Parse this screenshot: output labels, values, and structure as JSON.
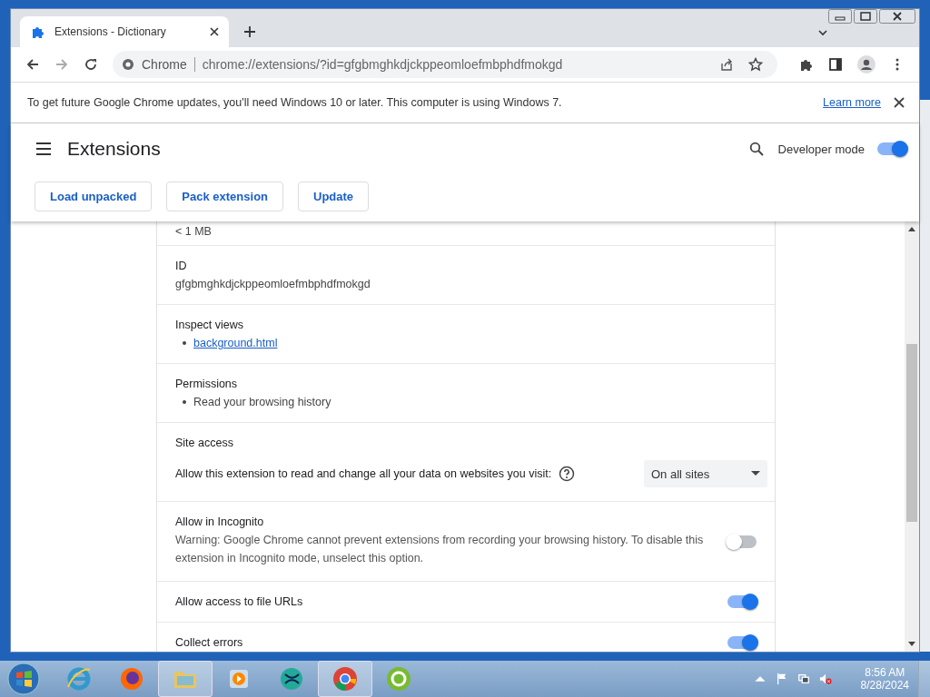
{
  "tabs": [
    {
      "label": "Extensions - Dictionary",
      "selected": true
    }
  ],
  "address": {
    "site_label": "Chrome",
    "url": "chrome://extensions/?id=gfgbmghkdjckppeomloefmbphdfmokgd"
  },
  "infobar": {
    "message": "To get future Google Chrome updates, you'll need Windows 10 or later. This computer is using Windows 7.",
    "link": "Learn more"
  },
  "header": {
    "title": "Extensions",
    "developer_mode": {
      "label": "Developer mode",
      "on": true
    }
  },
  "buttons": [
    "Load unpacked",
    "Pack extension",
    "Update"
  ],
  "details": {
    "size": "< 1 MB",
    "id": {
      "label": "ID",
      "value": "gfgbmghkdjckppeomloefmbphdfmokgd"
    },
    "inspect_views": {
      "label": "Inspect views",
      "links": [
        "background.html"
      ]
    },
    "permissions": {
      "label": "Permissions",
      "items": [
        "Read your browsing history"
      ]
    },
    "site_access": {
      "heading": "Site access",
      "prompt": "Allow this extension to read and change all your data on websites you visit:",
      "dropdown": "On all sites"
    },
    "toggles": [
      {
        "title": "Allow in Incognito",
        "description": "Warning: Google Chrome cannot prevent extensions from recording your browsing history. To disable this extension in Incognito mode, unselect this option.",
        "on": false
      },
      {
        "title": "Allow access to file URLs",
        "on": true
      },
      {
        "title": "Collect errors",
        "on": true
      }
    ]
  },
  "taskbar": {
    "time": "8:56 AM",
    "date": "8/28/2024"
  }
}
